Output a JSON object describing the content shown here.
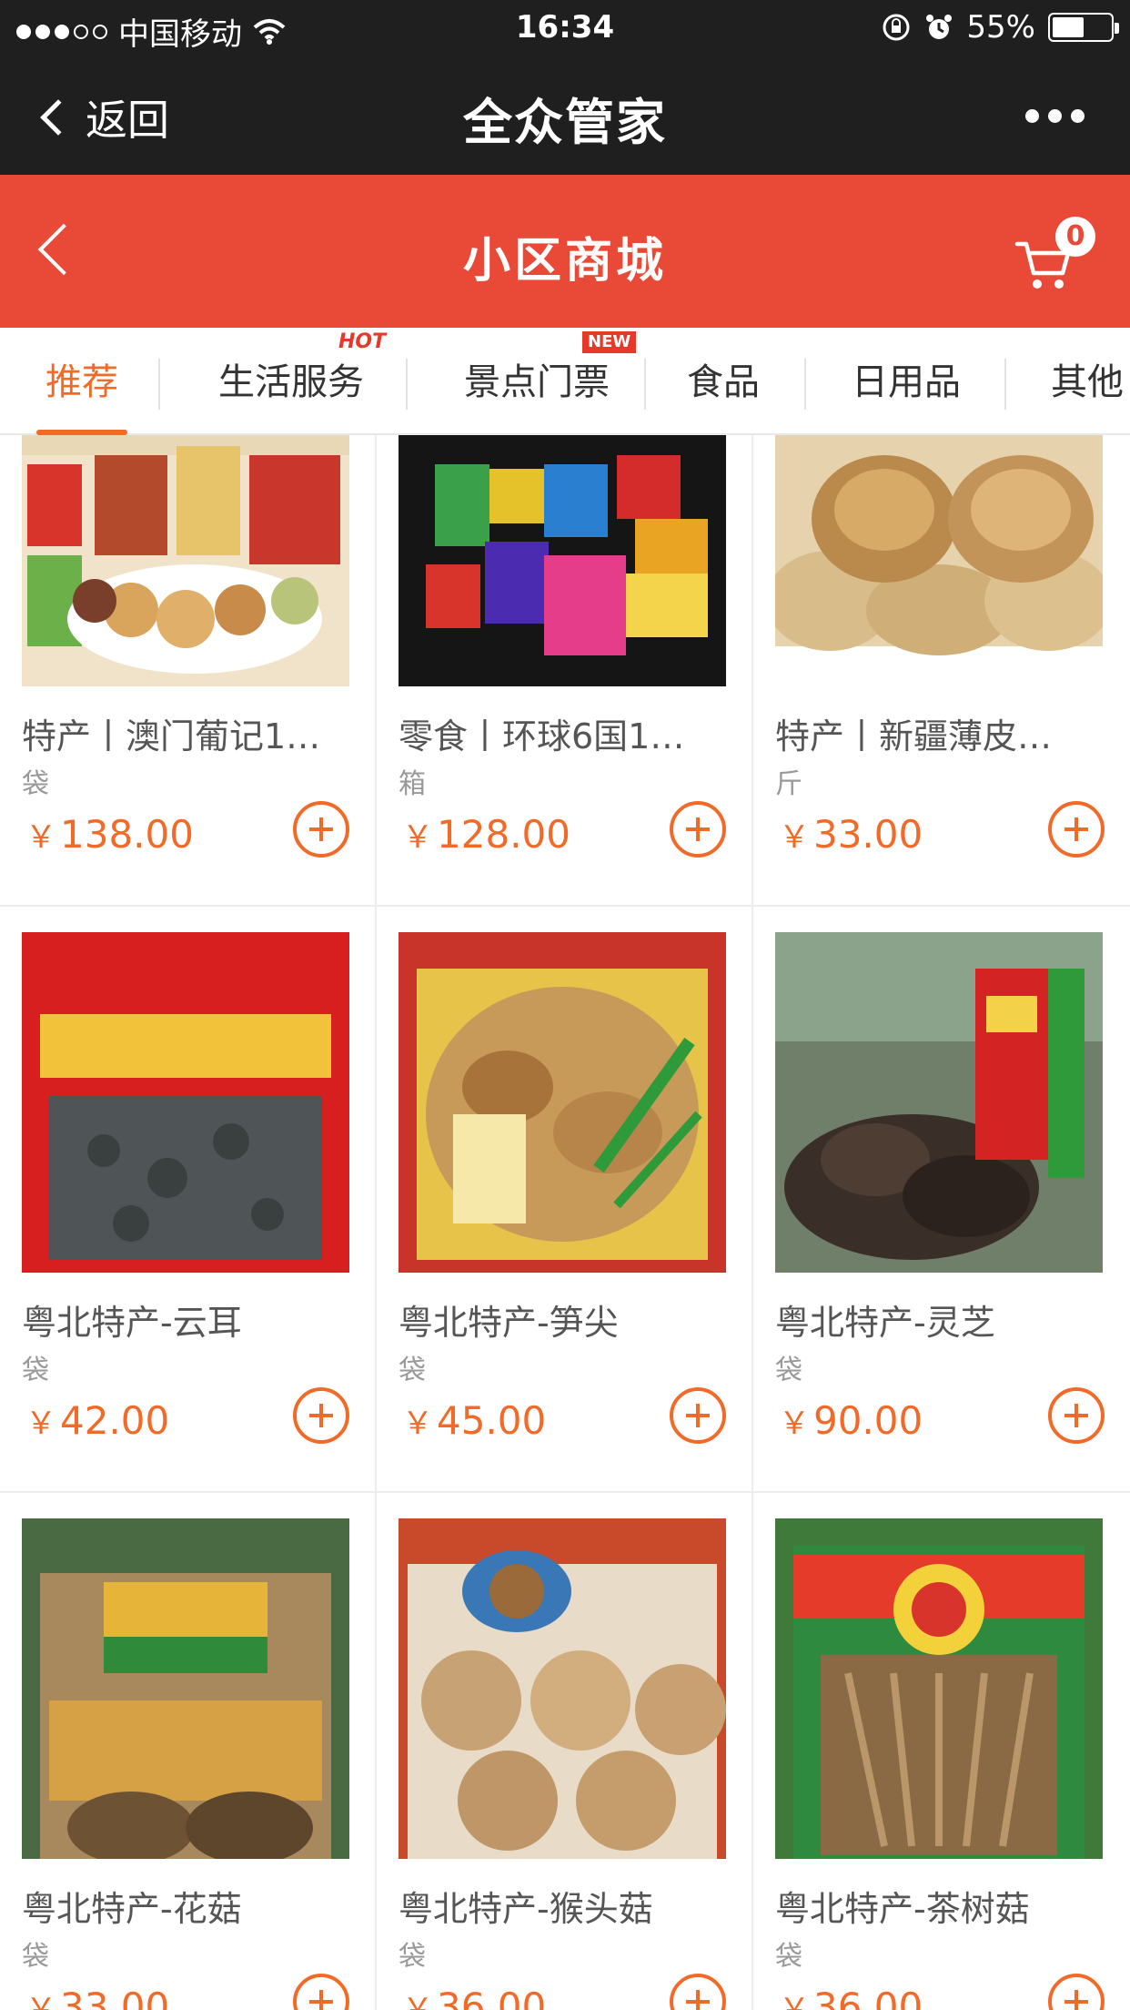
{
  "status_bar": {
    "carrier": "中国移动",
    "time": "16:34",
    "battery_text": "55%",
    "battery_level": 0.55
  },
  "nav": {
    "back_label": "返回",
    "title": "全众管家"
  },
  "mall": {
    "title": "小区商城",
    "cart_count": "0"
  },
  "tabs": [
    {
      "label": "推荐",
      "active": true
    },
    {
      "label": "生活服务",
      "flag": "HOT"
    },
    {
      "label": "景点门票",
      "flag": "NEW"
    },
    {
      "label": "食品"
    },
    {
      "label": "日用品"
    },
    {
      "label": "其他"
    }
  ],
  "currency": "￥",
  "products": [
    {
      "name": "特产丨澳门葡记1…",
      "unit": "袋",
      "price": "138.00",
      "image": "macau-snack-assortment"
    },
    {
      "name": "零食丨环球6国1…",
      "unit": "箱",
      "price": "128.00",
      "image": "global-snack-box"
    },
    {
      "name": "特产丨新疆薄皮…",
      "unit": "斤",
      "price": "33.00",
      "image": "xinjiang-walnuts"
    },
    {
      "name": "粤北特产-云耳",
      "unit": "袋",
      "price": "42.00",
      "image": "cloud-ear-fungus-bag"
    },
    {
      "name": "粤北特产-笋尖",
      "unit": "袋",
      "price": "45.00",
      "image": "bamboo-shoot-bag"
    },
    {
      "name": "粤北特产-灵芝",
      "unit": "袋",
      "price": "90.00",
      "image": "lingzhi-bag"
    },
    {
      "name": "粤北特产-花菇",
      "unit": "袋",
      "price": "33.00",
      "image": "flower-mushroom-bag"
    },
    {
      "name": "粤北特产-猴头菇",
      "unit": "袋",
      "price": "36.00",
      "image": "monkey-head-mushroom-bag"
    },
    {
      "name": "粤北特产-茶树菇",
      "unit": "袋",
      "price": "36.00",
      "image": "tea-tree-mushroom-bag"
    }
  ]
}
